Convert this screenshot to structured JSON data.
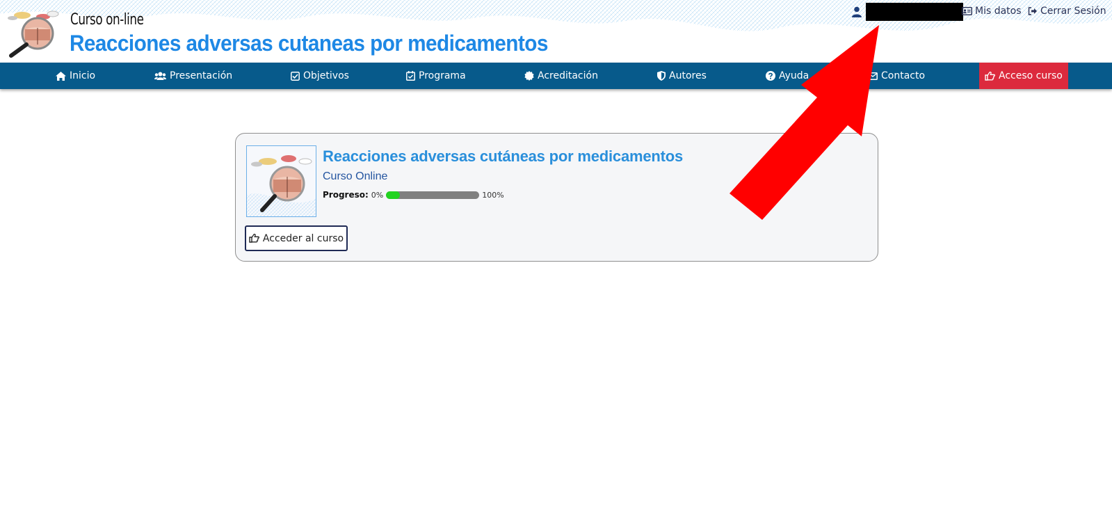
{
  "header": {
    "subtitle": "Curso on-line",
    "title": "Reacciones adversas cutaneas por medicamentos",
    "logo_icon": "magnifier-skin-logo"
  },
  "user_bar": {
    "user_icon": "user-icon",
    "my_data_label": "Mis datos",
    "my_data_icon": "id-card-icon",
    "logout_label": "Cerrar Sesión",
    "logout_icon": "sign-out-icon"
  },
  "nav": {
    "items": [
      {
        "label": "Inicio",
        "icon": "home-icon"
      },
      {
        "label": "Presentación",
        "icon": "users-icon"
      },
      {
        "label": "Objetivos",
        "icon": "check-square-icon"
      },
      {
        "label": "Programa",
        "icon": "calendar-check-icon"
      },
      {
        "label": "Acreditación",
        "icon": "certificate-icon"
      },
      {
        "label": "Autores",
        "icon": "shield-icon"
      },
      {
        "label": "Ayuda",
        "icon": "question-circle-icon"
      },
      {
        "label": "Contacto",
        "icon": "envelope-icon"
      },
      {
        "label": "Acceso curso",
        "icon": "hand-point-right-icon",
        "active": true
      }
    ]
  },
  "course_card": {
    "title": "Reacciones adversas cutáneas por medicamentos",
    "subtitle": "Curso Online",
    "progress_label": "Progreso:",
    "progress_min": "0%",
    "progress_max": "100%",
    "progress_value": 0.15,
    "button_label": "Acceder al curso",
    "button_icon": "hand-point-right-icon"
  },
  "colors": {
    "nav_bg": "#075a8b",
    "active_nav": "#dc2a3d",
    "title_blue": "#1e88e5",
    "progress_fill": "#22d320",
    "annotation_arrow": "#ff0000"
  }
}
